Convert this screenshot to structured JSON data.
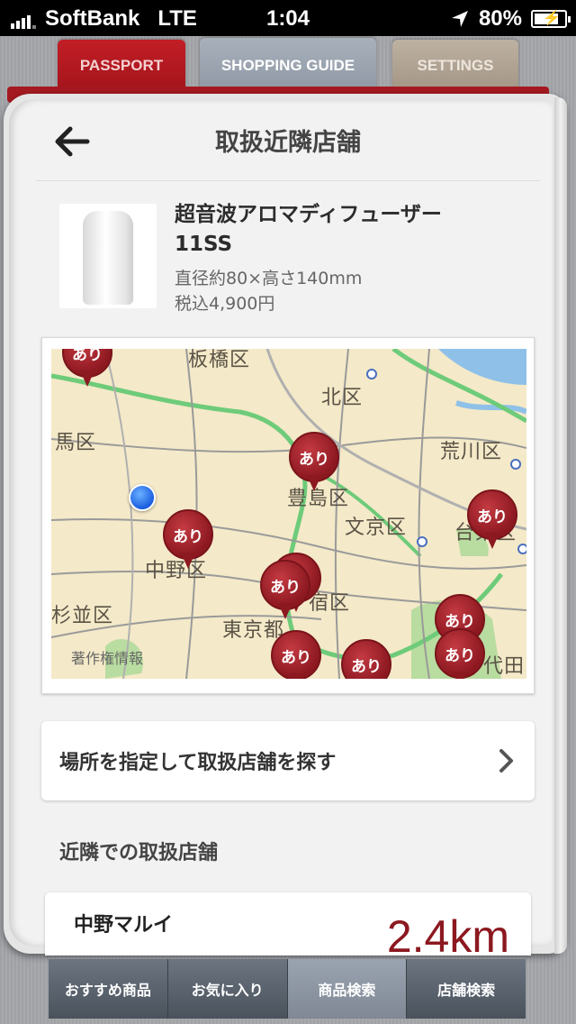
{
  "status_bar": {
    "carrier": "SoftBank",
    "network": "LTE",
    "time": "1:04",
    "battery": "80%",
    "battery_level": 0.8
  },
  "top_tabs": [
    {
      "label": "PASSPORT",
      "color": "#b51a21"
    },
    {
      "label": "SHOPPING GUIDE",
      "color": "#9aa3ae",
      "active": true
    },
    {
      "label": "SETTINGS",
      "color": "#b0a493"
    }
  ],
  "header": {
    "title": "取扱近隣店舗",
    "back_icon": "back-arrow-icon"
  },
  "product": {
    "name_line1": "超音波アロマディフューザー",
    "name_line2": "11SS",
    "size": "直径約80×高さ140mm",
    "price": "税込4,900円"
  },
  "map": {
    "labels": [
      "板橋区",
      "北区",
      "馬区",
      "荒川区",
      "豊島区",
      "文京区",
      "台東区",
      "中野区",
      "杉並区",
      "宿区",
      "東京都",
      "代田"
    ],
    "copyright": "著作権情報",
    "pin_label": "あり",
    "pin_color": "#8c1820"
  },
  "search_location": {
    "label": "場所を指定して取扱店舗を探す"
  },
  "nearby": {
    "section_title": "近隣での取扱店舗",
    "stores": [
      {
        "name": "中野マルイ",
        "distance": "2.4km"
      }
    ]
  },
  "bottom_tabs": [
    {
      "label": "おすすめ商品"
    },
    {
      "label": "お気に入り"
    },
    {
      "label": "商品検索",
      "active": true
    },
    {
      "label": "店舗検索"
    }
  ]
}
